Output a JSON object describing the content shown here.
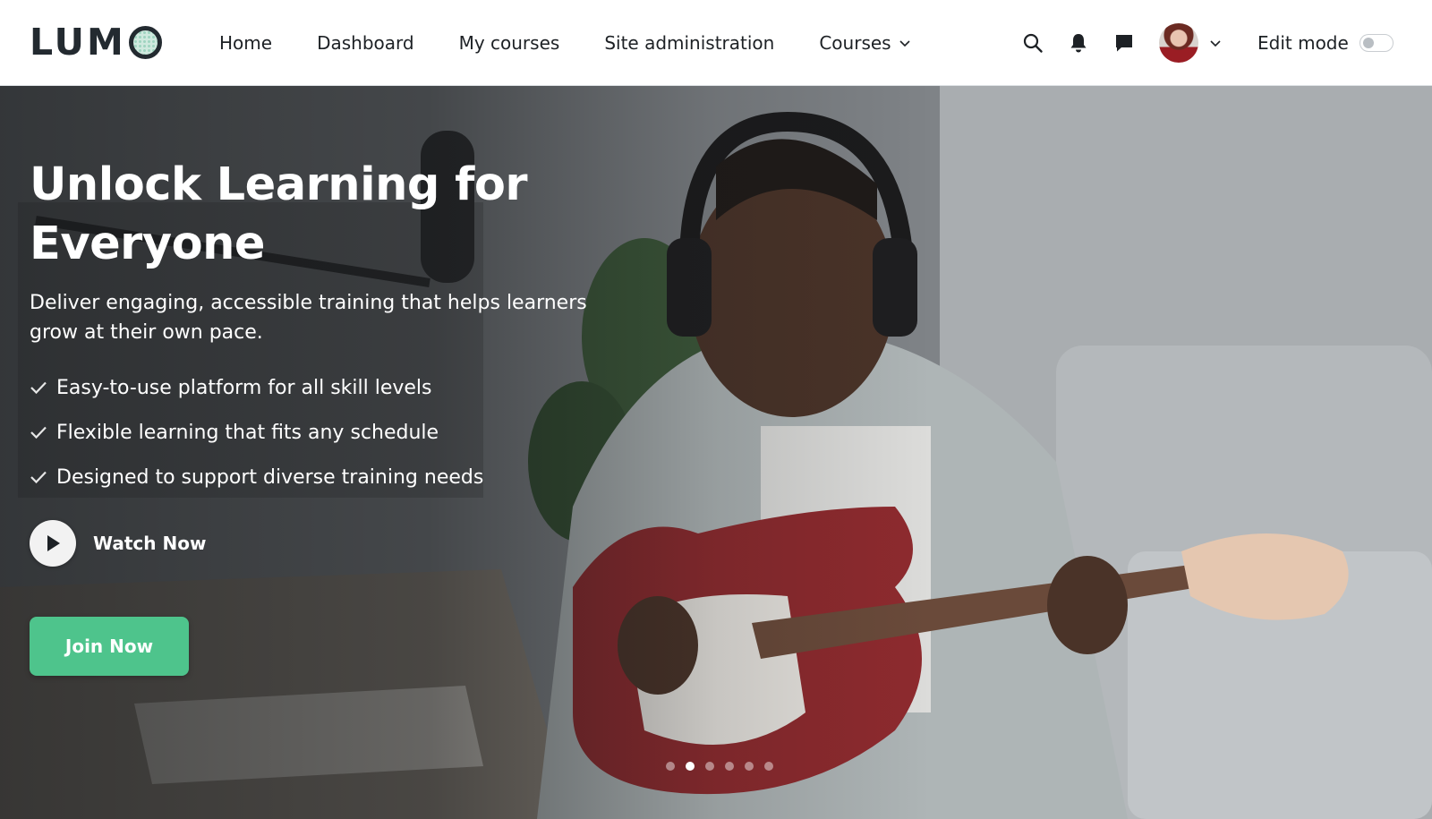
{
  "brand": {
    "logo_text": "LUM"
  },
  "nav": {
    "items": [
      {
        "label": "Home"
      },
      {
        "label": "Dashboard"
      },
      {
        "label": "My courses"
      },
      {
        "label": "Site administration"
      },
      {
        "label": "Courses",
        "has_dropdown": true
      }
    ]
  },
  "header": {
    "icons": [
      "search-icon",
      "bell-icon",
      "chat-icon"
    ],
    "user_menu": {
      "avatar": "user-avatar",
      "dropdown_icon": "chevron-down-icon"
    },
    "edit_mode": {
      "label": "Edit mode",
      "enabled": false
    }
  },
  "hero": {
    "title": "Unlock Learning for Everyone",
    "subtitle": "Deliver engaging, accessible training that helps learners grow at their own pace.",
    "features": [
      "Easy-to-use platform for all skill levels",
      "Flexible learning that fits any schedule",
      "Designed to support diverse training needs"
    ],
    "watch_label": "Watch Now",
    "cta_label": "Join Now",
    "carousel": {
      "slides": 6,
      "active_index": 1
    }
  },
  "colors": {
    "accent": "#4ec48c",
    "text_dark": "#1d2125",
    "logo_dot": "#cfe9de"
  }
}
